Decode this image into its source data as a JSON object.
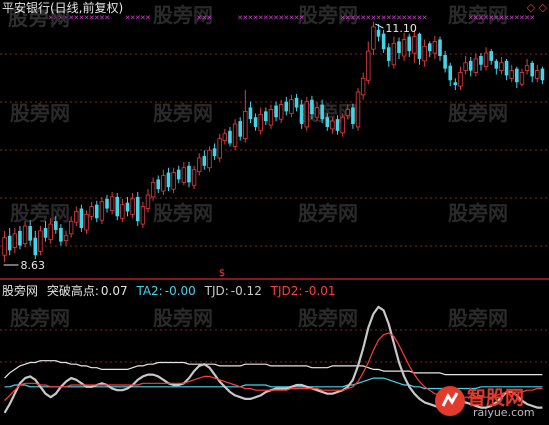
{
  "title_bar": {
    "title": "平安银行(日线,前复权)",
    "right_icons": "◇ ◇"
  },
  "watermark": {
    "text": "股旁网"
  },
  "colors": {
    "background": "#000000",
    "up": "#e03c3c",
    "down": "#44d4e8",
    "grid": "#8a1f1f",
    "separator": "#b02020",
    "label_white": "#e6e6e6",
    "ta2": "#44d4e8",
    "tjd": "#c8c8c8",
    "tjd2": "#ff3c3c",
    "signal": "#d23cd2",
    "marker": "#ff3c3c"
  },
  "main_panel": {
    "type": "candlestick",
    "high_label": "11.10",
    "low_label": "8.63",
    "signal_marker": "✕",
    "bottom_marker": "$",
    "close": [
      8.88,
      8.75,
      8.92,
      8.8,
      9.0,
      8.85,
      8.7,
      8.95,
      8.88,
      9.02,
      8.96,
      8.84,
      8.9,
      9.05,
      9.15,
      8.98,
      9.12,
      9.2,
      9.08,
      9.25,
      9.18,
      9.3,
      9.1,
      9.22,
      9.15,
      9.28,
      9.05,
      9.2,
      9.32,
      9.45,
      9.38,
      9.52,
      9.4,
      9.55,
      9.48,
      9.6,
      9.45,
      9.58,
      9.7,
      9.62,
      9.78,
      9.72,
      9.9,
      9.95,
      9.85,
      10.05,
      9.92,
      10.18,
      10.1,
      10.02,
      10.15,
      10.08,
      10.2,
      10.12,
      10.25,
      10.18,
      10.3,
      10.22,
      10.05,
      10.28,
      10.15,
      10.22,
      10.1,
      10.02,
      10.08,
      9.98,
      10.12,
      10.2,
      10.05,
      10.38,
      10.52,
      10.8,
      11.05,
      10.95,
      10.82,
      10.7,
      10.88,
      10.78,
      10.92,
      10.8,
      10.95,
      10.72,
      10.85,
      10.8,
      10.9,
      10.75,
      10.62,
      10.5,
      10.45,
      10.58,
      10.68,
      10.6,
      10.72,
      10.66,
      10.78,
      10.7,
      10.62,
      10.68,
      10.55,
      10.6,
      10.48,
      10.58,
      10.65,
      10.54,
      10.6,
      10.5
    ],
    "open": [
      8.7,
      8.9,
      8.78,
      8.95,
      8.82,
      9.0,
      8.88,
      8.74,
      8.98,
      8.86,
      9.05,
      8.98,
      8.85,
      8.92,
      9.04,
      9.18,
      8.96,
      9.1,
      9.22,
      9.06,
      9.28,
      9.16,
      9.3,
      9.08,
      9.24,
      9.12,
      9.3,
      9.02,
      9.18,
      9.3,
      9.48,
      9.36,
      9.55,
      9.38,
      9.58,
      9.45,
      9.62,
      9.42,
      9.56,
      9.72,
      9.6,
      9.8,
      9.7,
      9.88,
      9.98,
      9.82,
      10.08,
      9.9,
      10.22,
      10.12,
      9.98,
      10.18,
      10.04,
      10.24,
      10.1,
      10.28,
      10.16,
      10.32,
      10.25,
      10.02,
      10.3,
      10.12,
      10.25,
      10.12,
      10.0,
      10.1,
      9.96,
      10.14,
      10.22,
      10.02,
      10.35,
      10.5,
      10.82,
      11.02,
      10.98,
      10.84,
      10.66,
      10.9,
      10.75,
      10.95,
      10.78,
      10.98,
      10.7,
      10.88,
      10.78,
      10.92,
      10.76,
      10.65,
      10.48,
      10.44,
      10.6,
      10.7,
      10.58,
      10.75,
      10.64,
      10.8,
      10.7,
      10.6,
      10.7,
      10.52,
      10.62,
      10.46,
      10.6,
      10.68,
      10.52,
      10.62
    ],
    "high": [
      8.95,
      8.98,
      8.98,
      9.0,
      9.05,
      9.06,
      8.95,
      9.0,
      9.05,
      9.08,
      9.1,
      9.02,
      8.95,
      9.1,
      9.2,
      9.22,
      9.16,
      9.25,
      9.26,
      9.3,
      9.32,
      9.35,
      9.34,
      9.28,
      9.3,
      9.34,
      9.35,
      9.25,
      9.38,
      9.5,
      9.52,
      9.58,
      9.6,
      9.6,
      9.62,
      9.66,
      9.66,
      9.62,
      9.75,
      9.78,
      9.82,
      9.85,
      9.95,
      10.0,
      10.02,
      10.1,
      10.12,
      10.4,
      10.28,
      10.16,
      10.22,
      10.22,
      10.25,
      10.28,
      10.3,
      10.33,
      10.35,
      10.36,
      10.3,
      10.33,
      10.34,
      10.28,
      10.3,
      10.16,
      10.12,
      10.14,
      10.16,
      10.25,
      10.26,
      10.42,
      10.58,
      10.9,
      11.1,
      11.08,
      11.02,
      10.88,
      10.95,
      10.94,
      10.99,
      10.98,
      11.02,
      10.99,
      10.92,
      10.9,
      10.96,
      10.95,
      10.8,
      10.68,
      10.52,
      10.64,
      10.75,
      10.74,
      10.78,
      10.78,
      10.84,
      10.82,
      10.72,
      10.74,
      10.72,
      10.66,
      10.64,
      10.62,
      10.72,
      10.7,
      10.66,
      10.64
    ],
    "low": [
      8.63,
      8.7,
      8.72,
      8.76,
      8.78,
      8.8,
      8.66,
      8.7,
      8.84,
      8.82,
      8.92,
      8.8,
      8.8,
      8.88,
      9.0,
      8.94,
      8.92,
      9.06,
      9.04,
      9.02,
      9.14,
      9.12,
      9.06,
      9.04,
      9.1,
      9.08,
      9.0,
      8.98,
      9.14,
      9.26,
      9.34,
      9.32,
      9.36,
      9.34,
      9.44,
      9.42,
      9.4,
      9.38,
      9.52,
      9.58,
      9.56,
      9.68,
      9.66,
      9.84,
      9.82,
      9.78,
      9.88,
      9.86,
      10.06,
      9.98,
      9.94,
      10.04,
      10.0,
      10.08,
      10.06,
      10.14,
      10.12,
      10.18,
      10.0,
      9.98,
      10.1,
      10.08,
      10.06,
      9.98,
      9.95,
      9.94,
      9.92,
      10.1,
      10.0,
      9.98,
      10.3,
      10.46,
      10.76,
      10.9,
      10.78,
      10.64,
      10.62,
      10.72,
      10.7,
      10.74,
      10.68,
      10.66,
      10.64,
      10.74,
      10.72,
      10.7,
      10.58,
      10.44,
      10.4,
      10.4,
      10.56,
      10.54,
      10.54,
      10.6,
      10.6,
      10.66,
      10.56,
      10.56,
      10.5,
      10.48,
      10.42,
      10.44,
      10.56,
      10.48,
      10.48,
      10.46
    ],
    "signal_dots": [
      [
        9,
        20
      ],
      [
        24,
        28
      ],
      [
        38,
        40
      ],
      [
        46,
        58
      ],
      [
        66,
        82
      ],
      [
        91,
        103
      ]
    ]
  },
  "indicator_panel": {
    "name": "股旁网",
    "indicator": "突破高点",
    "values": [
      {
        "name": "突破高点:",
        "value": "0.07",
        "color": "#e6e6e6"
      },
      {
        "name": "TA2:",
        "value": "-0.00",
        "color": "#44d4e8"
      },
      {
        "name": "TJD:",
        "value": "-0.12",
        "color": "#c8c8c8"
      },
      {
        "name": "TJD2:",
        "value": "-0.01",
        "color": "#ff3c3c"
      }
    ]
  },
  "chart_data": {
    "type": "line",
    "title": "平安银行(日线,前复权)",
    "price_range": [
      8.63,
      11.1
    ],
    "price_annotations": {
      "high": "11.10",
      "low": "8.63"
    },
    "legend": [
      "突破高点: 0.07",
      "TA2: -0.00",
      "TJD: -0.12",
      "TJD2: -0.01"
    ],
    "series": [
      {
        "name": "突破高点",
        "color": "#e6e6e6",
        "values": [
          0.05,
          0.08,
          0.1,
          0.12,
          0.13,
          0.14,
          0.14,
          0.15,
          0.15,
          0.15,
          0.15,
          0.14,
          0.14,
          0.13,
          0.13,
          0.12,
          0.12,
          0.11,
          0.11,
          0.1,
          0.1,
          0.1,
          0.1,
          0.1,
          0.1,
          0.11,
          0.12,
          0.12,
          0.13,
          0.13,
          0.14,
          0.14,
          0.14,
          0.14,
          0.14,
          0.14,
          0.13,
          0.13,
          0.13,
          0.13,
          0.13,
          0.13,
          0.12,
          0.12,
          0.12,
          0.12,
          0.12,
          0.13,
          0.13,
          0.13,
          0.13,
          0.13,
          0.12,
          0.12,
          0.12,
          0.12,
          0.12,
          0.12,
          0.12,
          0.12,
          0.11,
          0.11,
          0.11,
          0.11,
          0.12,
          0.12,
          0.12,
          0.12,
          0.12,
          0.12,
          0.12,
          0.11,
          0.1,
          0.1,
          0.09,
          0.09,
          0.09,
          0.09,
          0.09,
          0.09,
          0.08,
          0.08,
          0.08,
          0.08,
          0.08,
          0.08,
          0.07,
          0.07,
          0.07,
          0.07,
          0.07,
          0.07,
          0.07,
          0.07,
          0.07,
          0.07,
          0.07,
          0.07,
          0.07,
          0.07,
          0.07,
          0.07,
          0.07,
          0.07,
          0.07,
          0.07
        ]
      },
      {
        "name": "TA2",
        "color": "#44d4e8",
        "values": [
          0.0,
          0.0,
          0.01,
          0.01,
          0.01,
          0.0,
          0.0,
          0.0,
          0.0,
          0.0,
          0.0,
          0.0,
          0.0,
          0.0,
          0.0,
          0.0,
          0.0,
          0.0,
          0.0,
          0.0,
          0.0,
          0.0,
          0.0,
          0.0,
          0.0,
          0.0,
          0.0,
          0.0,
          0.0,
          0.0,
          0.0,
          0.0,
          0.0,
          0.0,
          0.0,
          0.0,
          0.0,
          0.0,
          0.0,
          0.0,
          0.0,
          0.0,
          0.0,
          0.0,
          0.0,
          0.0,
          0.0,
          0.01,
          0.01,
          0.01,
          0.01,
          0.01,
          0.0,
          0.0,
          0.0,
          0.0,
          0.0,
          0.0,
          0.0,
          0.0,
          0.0,
          0.0,
          0.0,
          0.0,
          0.0,
          0.0,
          0.0,
          0.01,
          0.01,
          0.02,
          0.03,
          0.04,
          0.05,
          0.05,
          0.05,
          0.04,
          0.03,
          0.02,
          0.01,
          0.01,
          0.0,
          0.0,
          -0.01,
          -0.01,
          -0.01,
          -0.01,
          -0.01,
          -0.01,
          -0.01,
          -0.01,
          -0.01,
          -0.01,
          -0.01,
          0.0,
          0.0,
          0.0,
          0.0,
          0.0,
          0.0,
          0.0,
          0.0,
          0.0,
          0.0,
          0.0,
          0.0,
          0.0
        ]
      },
      {
        "name": "TJD",
        "color": "#c8c8c8",
        "values": [
          -0.15,
          -0.1,
          -0.04,
          0.02,
          0.05,
          0.06,
          0.04,
          0.0,
          -0.04,
          -0.06,
          -0.04,
          0.0,
          0.03,
          0.05,
          0.04,
          0.02,
          0.0,
          0.0,
          0.01,
          0.02,
          0.01,
          -0.01,
          -0.02,
          -0.02,
          -0.01,
          0.01,
          0.04,
          0.06,
          0.07,
          0.07,
          0.06,
          0.04,
          0.02,
          0.01,
          0.01,
          0.02,
          0.05,
          0.09,
          0.12,
          0.13,
          0.11,
          0.07,
          0.03,
          0.0,
          -0.03,
          -0.05,
          -0.06,
          -0.07,
          -0.07,
          -0.06,
          -0.05,
          -0.03,
          -0.02,
          -0.01,
          -0.01,
          -0.01,
          0.0,
          0.01,
          0.01,
          0.0,
          -0.01,
          -0.02,
          -0.03,
          -0.04,
          -0.04,
          -0.03,
          -0.02,
          0.0,
          0.04,
          0.12,
          0.22,
          0.34,
          0.42,
          0.46,
          0.44,
          0.36,
          0.25,
          0.14,
          0.06,
          0.0,
          -0.04,
          -0.07,
          -0.09,
          -0.1,
          -0.11,
          -0.12,
          -0.12,
          -0.11,
          -0.1,
          -0.09,
          -0.09,
          -0.1,
          -0.11,
          -0.12,
          -0.12,
          -0.11,
          -0.09,
          -0.06,
          -0.03,
          -0.03,
          -0.05,
          -0.08,
          -0.1,
          -0.11,
          -0.12,
          -0.12
        ]
      },
      {
        "name": "TJD2",
        "color": "#ff3c3c",
        "values": [
          -0.08,
          -0.05,
          -0.02,
          0.01,
          0.02,
          0.02,
          0.02,
          0.01,
          0.01,
          0.0,
          0.0,
          0.0,
          0.0,
          0.01,
          0.01,
          0.01,
          0.01,
          0.01,
          0.01,
          0.01,
          0.01,
          0.01,
          0.01,
          0.01,
          0.01,
          0.01,
          0.01,
          0.02,
          0.02,
          0.02,
          0.02,
          0.02,
          0.02,
          0.02,
          0.02,
          0.02,
          0.03,
          0.04,
          0.05,
          0.06,
          0.06,
          0.05,
          0.04,
          0.03,
          0.02,
          0.01,
          0.0,
          -0.01,
          -0.01,
          -0.02,
          -0.02,
          -0.02,
          -0.02,
          -0.02,
          -0.02,
          -0.02,
          -0.01,
          -0.01,
          -0.01,
          -0.01,
          -0.01,
          -0.01,
          -0.02,
          -0.02,
          -0.02,
          -0.02,
          -0.02,
          -0.01,
          0.0,
          0.03,
          0.08,
          0.14,
          0.21,
          0.27,
          0.3,
          0.31,
          0.29,
          0.24,
          0.18,
          0.12,
          0.07,
          0.03,
          0.0,
          -0.02,
          -0.04,
          -0.05,
          -0.06,
          -0.06,
          -0.06,
          -0.06,
          -0.06,
          -0.06,
          -0.06,
          -0.06,
          -0.06,
          -0.06,
          -0.05,
          -0.04,
          -0.03,
          -0.03,
          -0.03,
          -0.03,
          -0.02,
          -0.02,
          -0.01,
          -0.01
        ]
      }
    ]
  },
  "logo": {
    "main": "智股网",
    "sub": "raiyue.com"
  }
}
